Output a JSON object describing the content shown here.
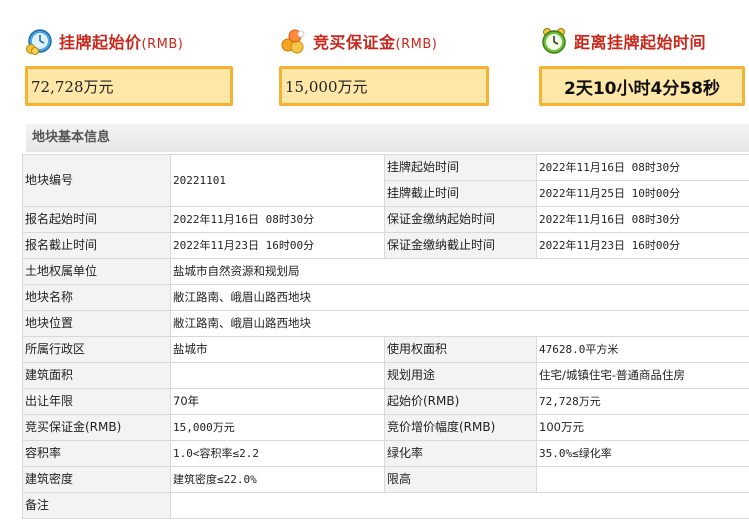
{
  "metrics": {
    "start_price": {
      "title": "挂牌起始价",
      "unit": "(RMB)",
      "value": "72,728万元",
      "icon": "coin-clock-icon"
    },
    "deposit": {
      "title": "竞买保证金",
      "unit": "(RMB)",
      "value": "15,000万元",
      "icon": "coins-icon"
    },
    "countdown": {
      "title": "距离挂牌起始时间",
      "value": "2天10小时4分58秒",
      "icon": "alarm-clock-icon"
    }
  },
  "section_title": "地块基本信息",
  "info": {
    "parcel_no": {
      "label": "地块编号",
      "value": "20221101"
    },
    "listing_start": {
      "label": "挂牌起始时间",
      "value": "2022年11月16日 08时30分"
    },
    "listing_end": {
      "label": "挂牌截止时间",
      "value": "2022年11月25日 10时00分"
    },
    "signup_start": {
      "label": "报名起始时间",
      "value": "2022年11月16日 08时30分"
    },
    "deposit_start": {
      "label": "保证金缴纳起始时间",
      "value": "2022年11月16日 08时30分"
    },
    "signup_end": {
      "label": "报名截止时间",
      "value": "2022年11月23日 16时00分"
    },
    "deposit_end": {
      "label": "保证金缴纳截止时间",
      "value": "2022年11月23日 16时00分"
    },
    "owner": {
      "label": "土地权属单位",
      "value": "盐城市自然资源和规划局"
    },
    "name": {
      "label": "地块名称",
      "value": "敝江路南、峨眉山路西地块"
    },
    "location": {
      "label": "地块位置",
      "value": "敝江路南、峨眉山路西地块"
    },
    "district": {
      "label": "所属行政区",
      "value": "盐城市"
    },
    "use_area": {
      "label": "使用权面积",
      "value": "47628.0平方米"
    },
    "build_area": {
      "label": "建筑面积",
      "value": ""
    },
    "purpose": {
      "label": "规划用途",
      "value": "住宅/城镇住宅-普通商品住房"
    },
    "term": {
      "label": "出让年限",
      "value": "70年"
    },
    "start_price": {
      "label": "起始价(RMB)",
      "value": "72,728万元"
    },
    "deposit": {
      "label": "竞买保证金(RMB)",
      "value": "15,000万元"
    },
    "increment": {
      "label": "竞价增价幅度(RMB)",
      "value": "100万元"
    },
    "far": {
      "label": "容积率",
      "value": "1.0<容积率≤2.2"
    },
    "green": {
      "label": "绿化率",
      "value": "35.0%≤绿化率"
    },
    "density": {
      "label": "建筑密度",
      "value": "建筑密度≤22.0%"
    },
    "height": {
      "label": "限高",
      "value": ""
    },
    "remark": {
      "label": "备注",
      "value": ""
    }
  }
}
